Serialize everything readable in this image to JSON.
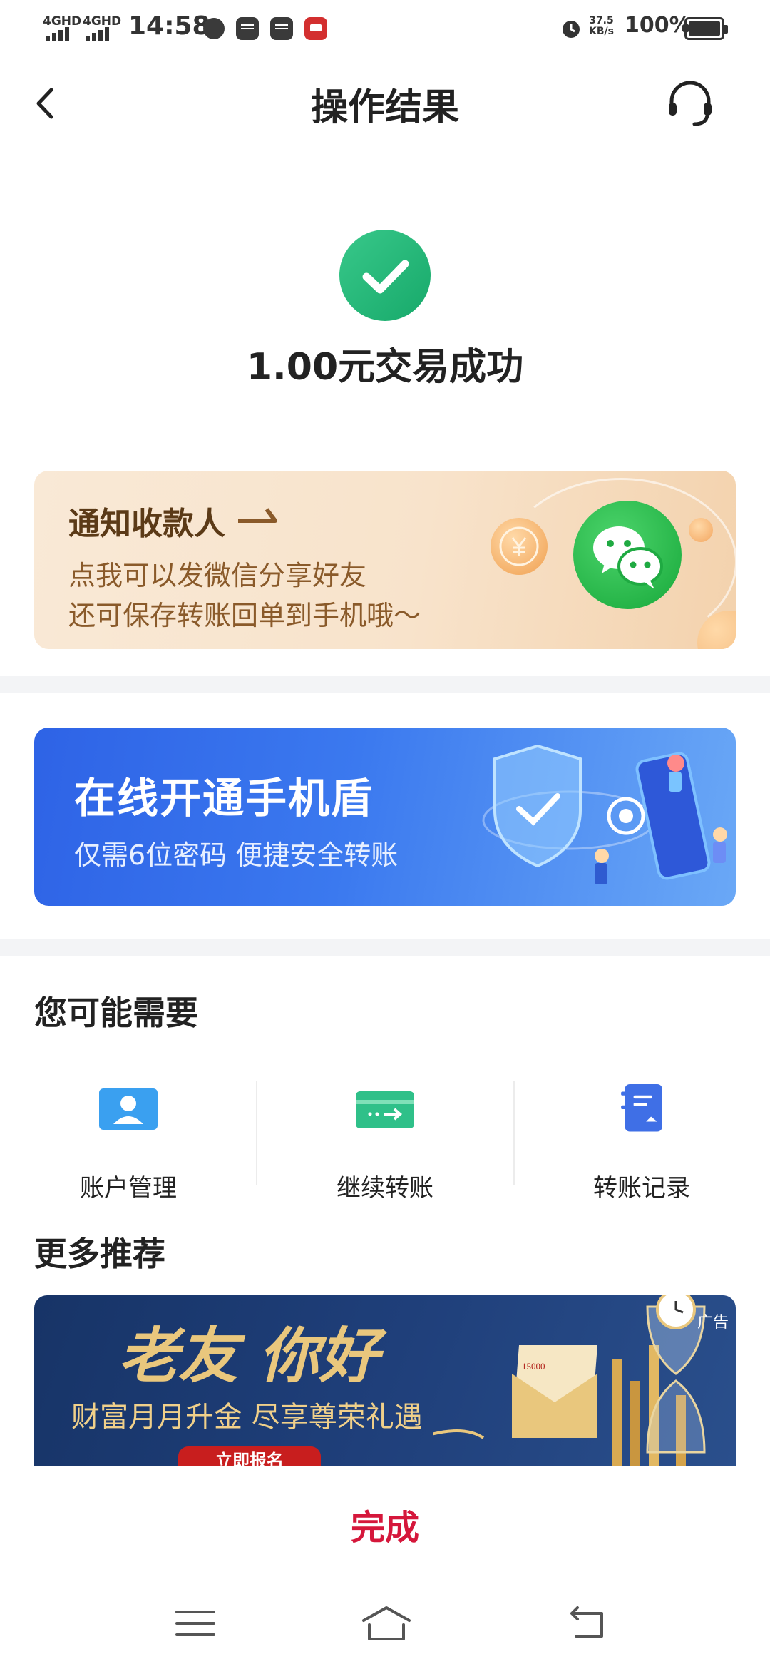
{
  "status_bar": {
    "network_1": "4GHD",
    "network_2": "4GHD",
    "time": "14:58",
    "speed_value": "37.5",
    "speed_unit": "KB/s",
    "battery": "100%"
  },
  "header": {
    "title": "操作结果",
    "back_icon": "chevron-left-icon",
    "service_icon": "headset-icon"
  },
  "result": {
    "message": "1.00元交易成功",
    "icon": "check-circle-icon"
  },
  "notify_banner": {
    "title": "通知收款人",
    "line1": "点我可以发微信分享好友",
    "line2": "还可保存转账回单到手机哦～"
  },
  "shield_banner": {
    "title": "在线开通手机盾",
    "subtitle": "仅需6位密码  便捷安全转账"
  },
  "recommend": {
    "heading": "您可能需要",
    "items": [
      {
        "label": "账户管理",
        "icon": "user-card-icon"
      },
      {
        "label": "继续转账",
        "icon": "transfer-card-icon"
      },
      {
        "label": "转账记录",
        "icon": "record-book-icon"
      }
    ]
  },
  "more": {
    "heading": "更多推荐",
    "ad_title": "老友 你好",
    "ad_subtitle": "财富月月升金  尽享尊荣礼遇",
    "ad_button": "立即报名",
    "ad_tag": "广告"
  },
  "footer": {
    "done_label": "完成"
  },
  "colors": {
    "accent_red": "#d5173b",
    "success_green": "#2fbf7f",
    "shield_blue": "#3270ea"
  }
}
